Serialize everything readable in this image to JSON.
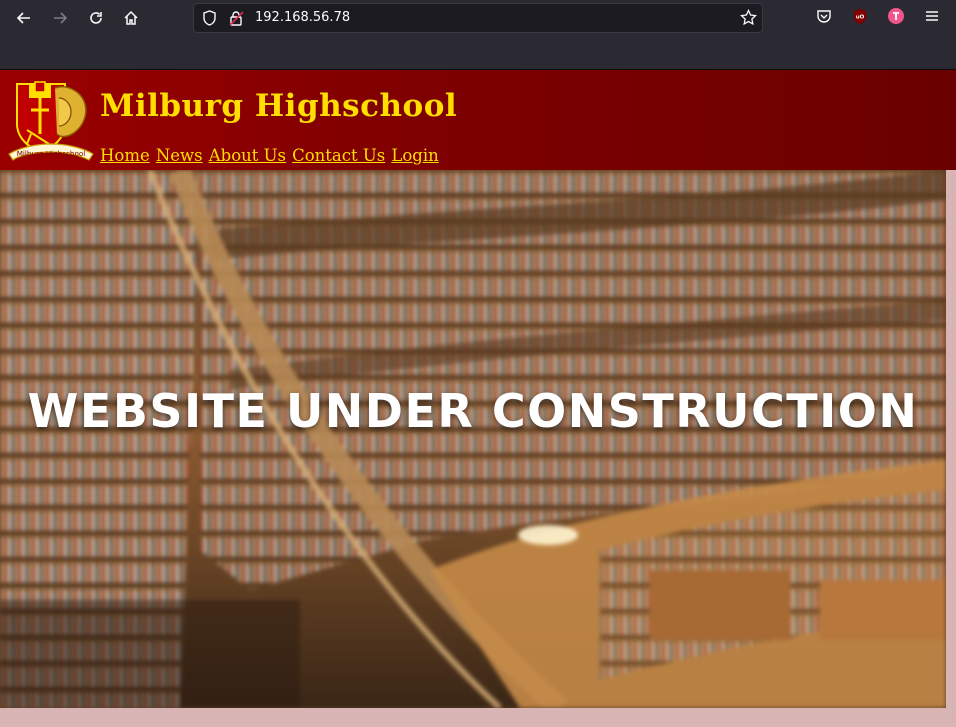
{
  "browser": {
    "url": "192.168.56.78",
    "icons": [
      "back-arrow-icon",
      "forward-arrow-icon",
      "reload-icon",
      "home-icon",
      "shield-icon",
      "insecure-lock-icon",
      "bookmark-star-icon",
      "pocket-icon",
      "ublock-icon",
      "extension-icon",
      "menu-hamburger-icon"
    ]
  },
  "site": {
    "title": "Milburg Highschool",
    "logo_text": "Milburg Highschool",
    "nav": [
      "Home",
      "News",
      "About Us",
      "Contact Us",
      "Login"
    ]
  },
  "hero": {
    "heading": "WEBSITE UNDER CONSTRUCTION"
  },
  "colors": {
    "header_red": "#800000",
    "title_gold": "#ffde00",
    "page_bg": "#d8b4b4",
    "chrome_bg": "#2b2a33"
  }
}
